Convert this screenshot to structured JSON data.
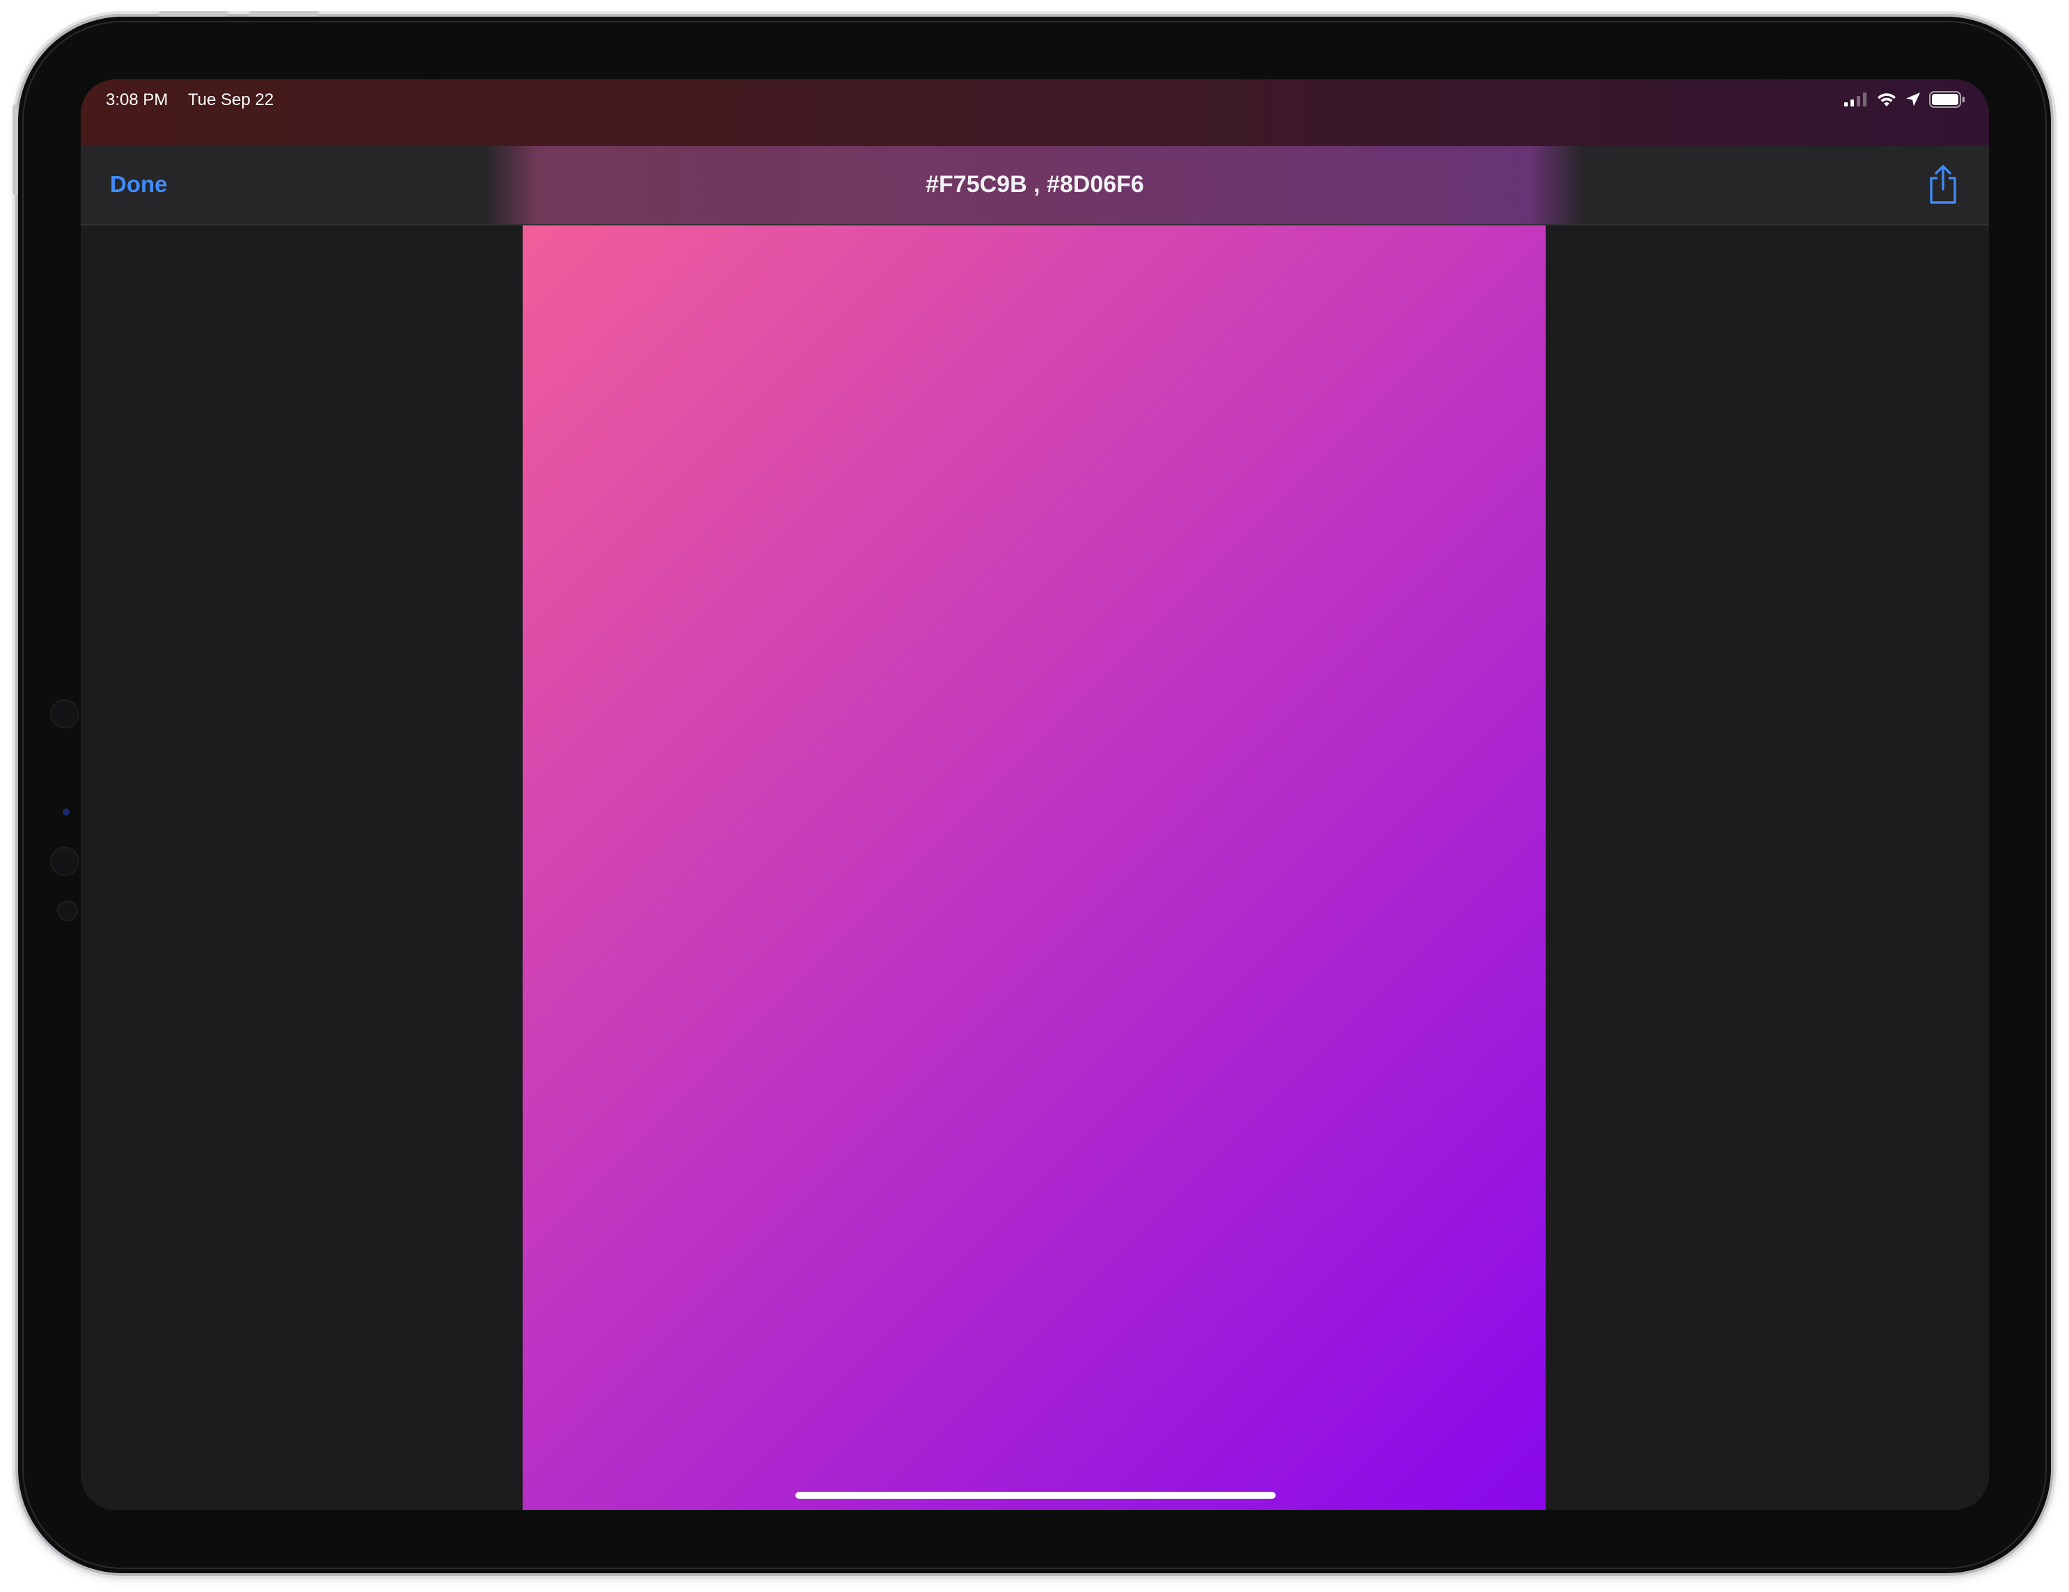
{
  "status_bar": {
    "time": "3:08 PM",
    "date": "Tue Sep 22",
    "icons": [
      "cellular-signal-icon",
      "wifi-icon",
      "location-arrow-icon",
      "battery-icon"
    ]
  },
  "nav": {
    "done_label": "Done",
    "title": "#F75C9B , #8D06F6",
    "share_icon": "share-icon"
  },
  "gradient": {
    "start_color": "#F75C9B",
    "end_color": "#8D06F6",
    "direction": "top-left to bottom-right"
  },
  "colors": {
    "accent": "#3F8CF7",
    "background": "#1C1C1E",
    "nav_background": "#262628"
  }
}
